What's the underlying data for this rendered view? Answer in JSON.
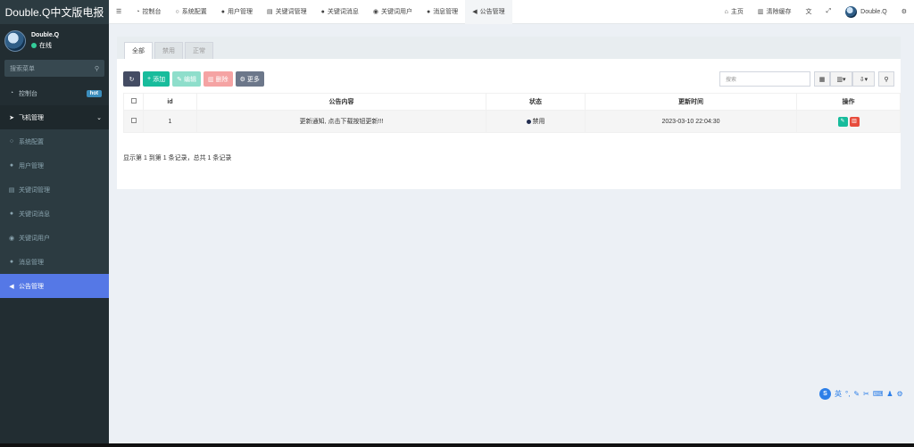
{
  "brand": "Double.Q中文版电报",
  "user": {
    "name": "Double.Q",
    "status": "在线"
  },
  "sidebar": {
    "search_placeholder": "搜索菜单",
    "items": [
      {
        "label": "控制台",
        "icon": "dashboard-icon",
        "badge": "hot"
      },
      {
        "label": "飞机管理",
        "icon": "paper-plane-icon"
      },
      {
        "label": "系统配置",
        "icon": "circle-icon"
      },
      {
        "label": "用户管理",
        "icon": "user-icon"
      },
      {
        "label": "关键词管理",
        "icon": "file-icon"
      },
      {
        "label": "关键词消息",
        "icon": "comment-icon"
      },
      {
        "label": "关键词用户",
        "icon": "user-circle-icon"
      },
      {
        "label": "消息管理",
        "icon": "comment-icon"
      },
      {
        "label": "公告管理",
        "icon": "bullhorn-icon"
      }
    ]
  },
  "topnav": {
    "tabs": [
      {
        "label": "控制台",
        "icon": "dashboard-icon"
      },
      {
        "label": "系统配置",
        "icon": "circle-icon"
      },
      {
        "label": "用户管理",
        "icon": "user-icon"
      },
      {
        "label": "关键词管理",
        "icon": "file-icon"
      },
      {
        "label": "关键词消息",
        "icon": "comment-icon"
      },
      {
        "label": "关键词用户",
        "icon": "user-circle-icon"
      },
      {
        "label": "消息管理",
        "icon": "comment-icon"
      },
      {
        "label": "公告管理",
        "icon": "bullhorn-icon"
      }
    ],
    "home": "主页",
    "clear_cache": "清除缓存",
    "username": "Double.Q"
  },
  "panel": {
    "tabs": [
      "全部",
      "禁用",
      "正常"
    ],
    "toolbar": {
      "add": "添加",
      "edit": "编辑",
      "delete": "删除",
      "more": "更多"
    },
    "search_placeholder": "搜索",
    "table": {
      "headers": [
        "id",
        "公告内容",
        "状态",
        "更新时间",
        "操作"
      ],
      "rows": [
        {
          "id": "1",
          "content": "更新通知, 点击下载按钮更新!!!",
          "status": "禁用",
          "updated": "2023-03-10 22:04:30"
        }
      ]
    },
    "page_info": "显示第 1 到第 1 条记录，总共 1 条记录"
  },
  "ime": {
    "lang": "英"
  },
  "colors": {
    "sidebar_bg": "#222d32",
    "active_menu": "#5578e6",
    "green": "#18bc9c",
    "red": "#e74c3c"
  }
}
